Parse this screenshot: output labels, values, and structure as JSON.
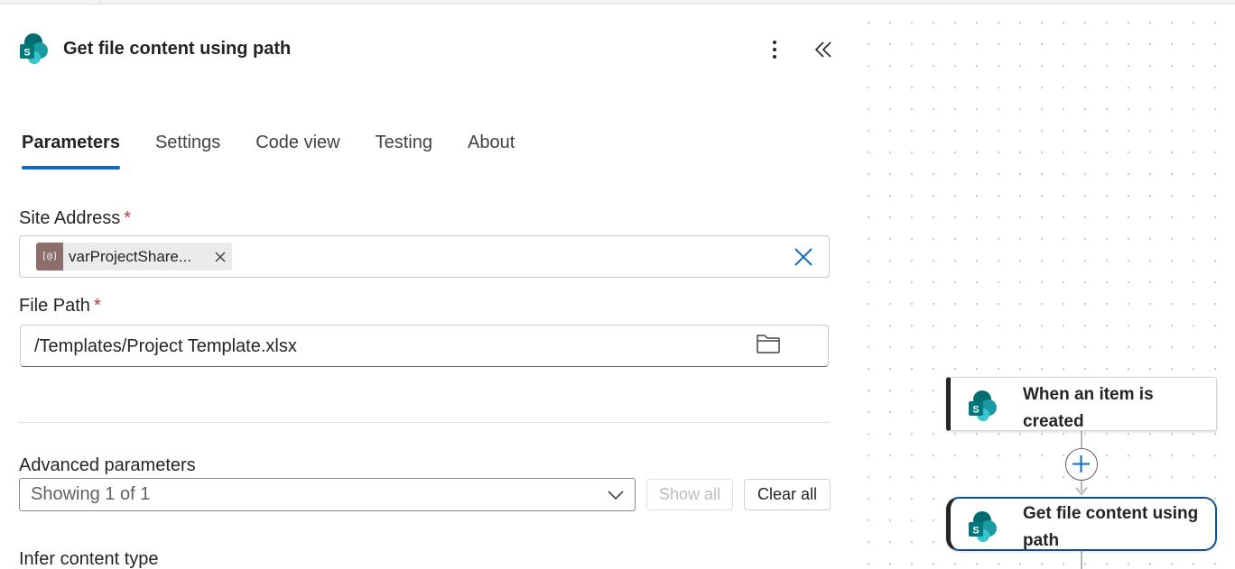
{
  "panel": {
    "title": "Get file content using path",
    "icon": "sharepoint-icon",
    "tabs": [
      {
        "label": "Parameters",
        "active": true
      },
      {
        "label": "Settings",
        "active": false
      },
      {
        "label": "Code view",
        "active": false
      },
      {
        "label": "Testing",
        "active": false
      },
      {
        "label": "About",
        "active": false
      }
    ],
    "site_address": {
      "label": "Site Address",
      "required": "*",
      "token": {
        "text": "varProjectShare...",
        "icon": "variable-icon"
      }
    },
    "file_path": {
      "label": "File Path",
      "required": "*",
      "value": "/Templates/Project Template.xlsx"
    },
    "advanced": {
      "label": "Advanced parameters",
      "select_value": "Showing 1 of 1",
      "show_all": "Show all",
      "clear_all": "Clear all"
    },
    "infer_label": "Infer content type"
  },
  "canvas": {
    "nodes": [
      {
        "title": "When an item is created",
        "icon": "sharepoint-icon"
      },
      {
        "title": "Get file content using path",
        "icon": "sharepoint-icon",
        "selected": true
      }
    ]
  },
  "colors": {
    "accent": "#0f6cbd",
    "required": "#c4314b",
    "token_icon_bg": "#8c6f6b",
    "selected_node_border": "#0f5199"
  }
}
